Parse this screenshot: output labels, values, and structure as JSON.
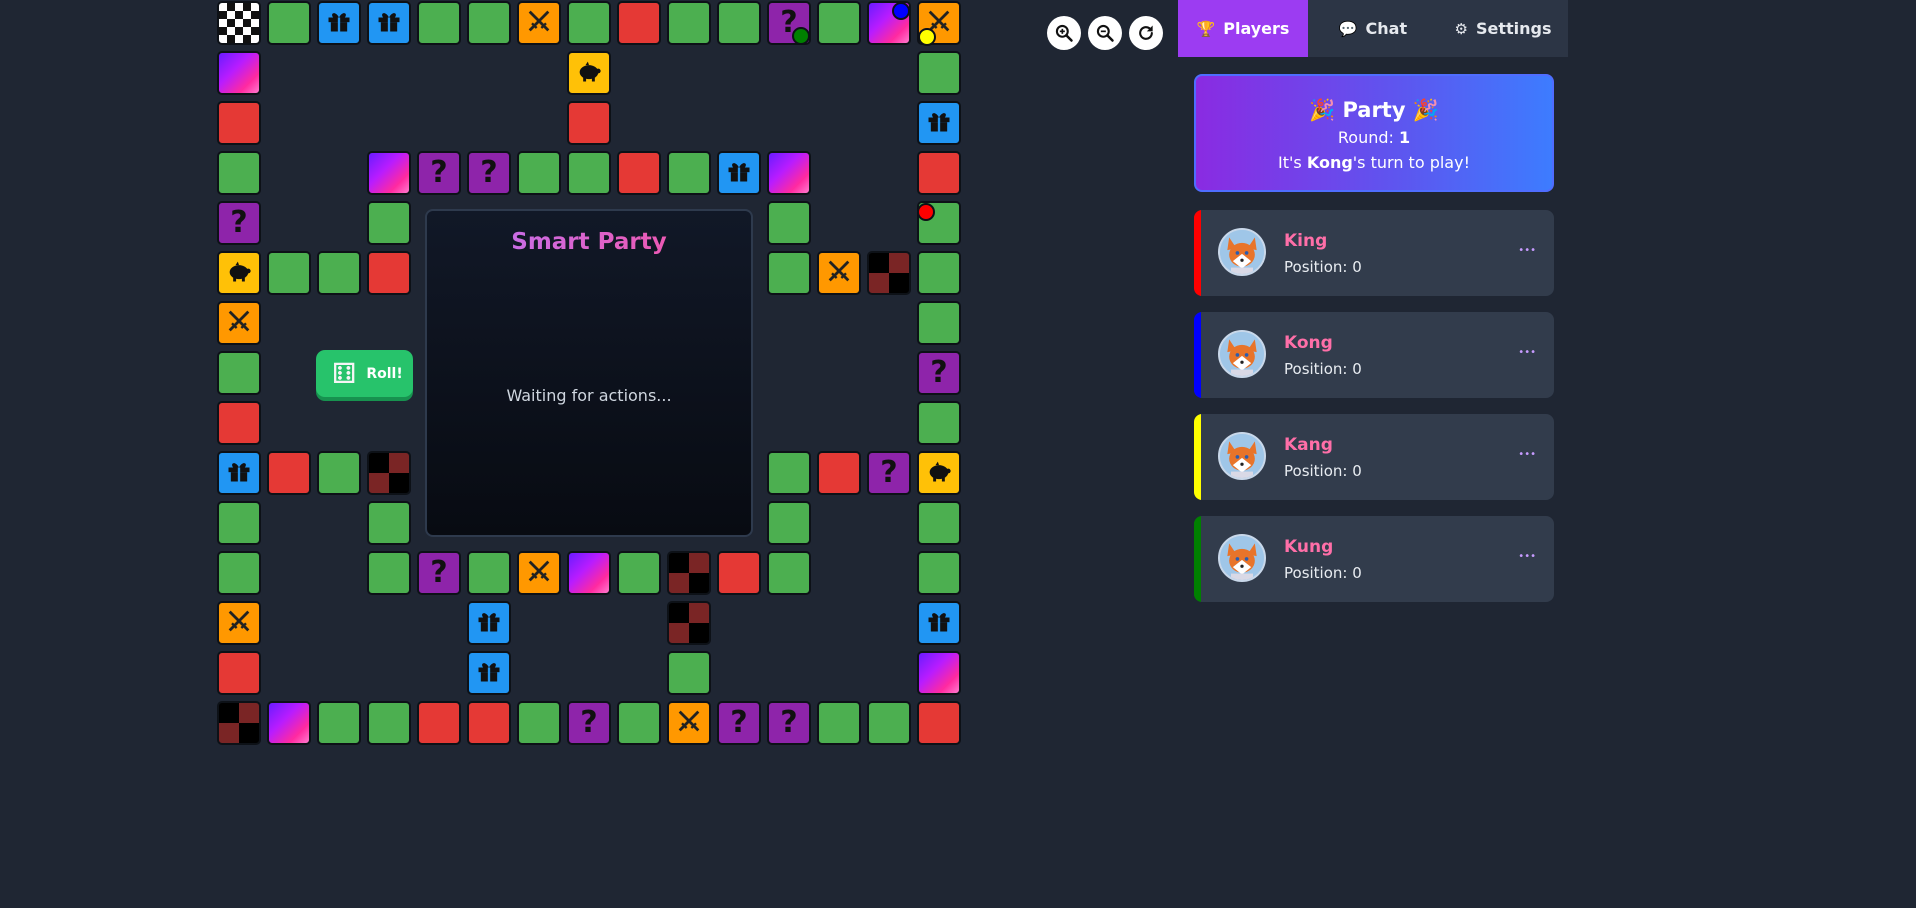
{
  "center": {
    "title": "Smart Party",
    "status": "Waiting for actions..."
  },
  "roll": {
    "label": "Roll!"
  },
  "sidebar": {
    "tabs": [
      {
        "icon": "🏆",
        "label": "Players"
      },
      {
        "icon": "💬",
        "label": "Chat"
      },
      {
        "icon": "⚙",
        "label": "Settings"
      }
    ],
    "party": {
      "title": "Party",
      "party_emoji": "🎉",
      "round_label": "Round:",
      "round_value": "1",
      "turn_prefix": "It's",
      "turn_player": "Kong",
      "turn_suffix": "'s turn to play!"
    },
    "players": [
      {
        "name": "King",
        "position_label": "Position:",
        "position": "0",
        "color": "#ff0000",
        "menu": "•••"
      },
      {
        "name": "Kong",
        "position_label": "Position:",
        "position": "0",
        "color": "#0000ff",
        "menu": "•••"
      },
      {
        "name": "Kang",
        "position_label": "Position:",
        "position": "0",
        "color": "#ffff00",
        "menu": "•••"
      },
      {
        "name": "Kung",
        "position_label": "Position:",
        "position": "0",
        "color": "#008000",
        "menu": "•••"
      }
    ]
  },
  "board": {
    "tile_colors": {
      "green": "#4caf50",
      "red": "#e53935",
      "blue": "#2196f3",
      "orange": "#ff9800",
      "purple": "#8e24aa",
      "yellow": "#ffc107"
    },
    "tile_type_icons": {
      "gift": "gift-icon",
      "battle": "crossed-swords-icon",
      "question": "question-mark",
      "piggy": "piggy-bank-icon",
      "checker": "checkered-pattern",
      "rainbow": "gradient",
      "finish": "finish-flag-pattern"
    },
    "token_colors": [
      "#0000ff",
      "#008000",
      "#ffff00",
      "#ff0000"
    ]
  },
  "toolbar": {
    "zoom_in": "zoom-in-icon",
    "zoom_out": "zoom-out-icon",
    "reset": "reset-icon"
  }
}
